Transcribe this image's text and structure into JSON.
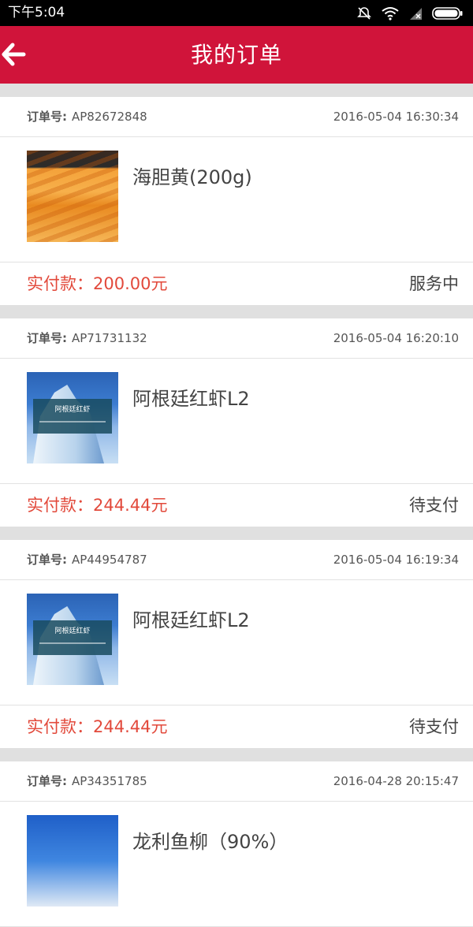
{
  "status_bar": {
    "time": "下午5:04"
  },
  "app_bar": {
    "title": "我的订单"
  },
  "order_no_label": "订单号:",
  "paid_label": "实付款：",
  "orders": [
    {
      "order_no": "AP82672848",
      "date": "2016-05-04 16:30:34",
      "product_name": "海胆黄(200g)",
      "amount": "200.00元",
      "status": "服务中"
    },
    {
      "order_no": "AP71731132",
      "date": "2016-05-04 16:20:10",
      "product_name": "阿根廷红虾L2",
      "amount": "244.44元",
      "status": "待支付"
    },
    {
      "order_no": "AP44954787",
      "date": "2016-05-04 16:19:34",
      "product_name": "阿根廷红虾L2",
      "amount": "244.44元",
      "status": "待支付"
    },
    {
      "order_no": "AP34351785",
      "date": "2016-04-28 20:15:47",
      "product_name": "龙利鱼柳（90%）",
      "amount": "",
      "status": ""
    }
  ],
  "thumbnail_text": {
    "iceberg_title": "阿根廷红虾"
  },
  "colors": {
    "appbar": "#d0143a",
    "price": "#e2493b"
  }
}
